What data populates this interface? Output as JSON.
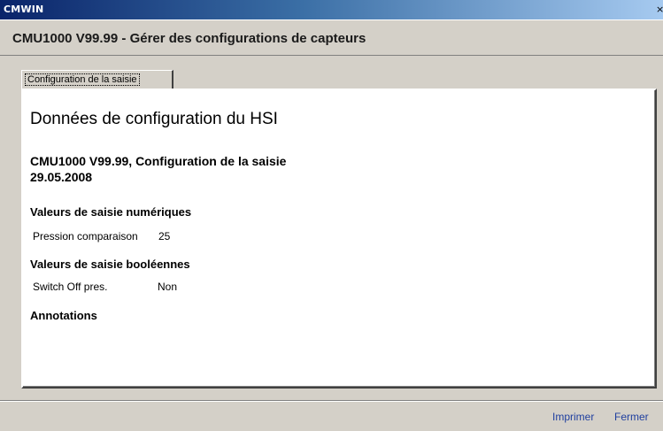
{
  "window": {
    "title": "CMWIN",
    "close_glyph": "×"
  },
  "header": {
    "title": "CMU1000 V99.99 - Gérer des configurations de capteurs"
  },
  "tabs": [
    {
      "label": "Configuration de la saisie"
    }
  ],
  "document": {
    "title": "Données de configuration du HSI",
    "subtitle": "CMU1000 V99.99, Configuration de la saisie",
    "date": "29.05.2008",
    "sections": {
      "numeric": {
        "heading": "Valeurs de saisie numériques",
        "rows": [
          {
            "label": "Pression comparaison",
            "value": "25"
          }
        ]
      },
      "boolean": {
        "heading": "Valeurs de saisie booléennes",
        "rows": [
          {
            "label": "Switch Off pres.",
            "value": "Non"
          }
        ]
      },
      "annotations": {
        "heading": "Annotations"
      }
    }
  },
  "footer": {
    "print_label": "Imprimer",
    "close_label": "Fermer"
  },
  "colors": {
    "titlebar_start": "#0a246a",
    "titlebar_end": "#a6caf0",
    "link": "#1f3f9f",
    "chrome": "#d4d0c8"
  }
}
